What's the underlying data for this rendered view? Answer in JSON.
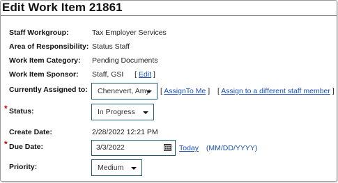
{
  "page_title": "Edit Work Item 21861",
  "fields": {
    "staff_workgroup": {
      "label": "Staff Workgroup:",
      "value": "Tax Employer Services"
    },
    "area": {
      "label": "Area of Responsibility:",
      "value": "Status Staff"
    },
    "category": {
      "label": "Work Item Category:",
      "value": "Pending Documents"
    },
    "sponsor": {
      "label": "Work Item Sponsor:",
      "value": "Staff, GSI",
      "edit_open": "[",
      "edit_link": "Edit",
      "edit_close": "]"
    },
    "assigned": {
      "label": "Currently Assigned to:",
      "selected": "Chenevert, Amy",
      "assign_me_open": "[",
      "assign_me_link": "AssignTo Me",
      "assign_me_close": "]",
      "assign_other_open": "[",
      "assign_other_link": "Assign to a different staff member",
      "assign_other_close": "]"
    },
    "status": {
      "required_mark": "*",
      "label": "Status:",
      "selected": "In Progress"
    },
    "create_date": {
      "label": "Create Date:",
      "value": "2/28/2022 12:21 PM"
    },
    "due_date": {
      "required_mark": "*",
      "label": "Due Date:",
      "value": "3/3/2022",
      "today_link": "Today",
      "format_hint": "(MM/DD/YYYY)"
    },
    "priority": {
      "label": "Priority:",
      "selected": "Medium"
    }
  },
  "icons": {
    "dropdown": "chevron-down-icon",
    "calendar": "calendar-icon"
  },
  "colors": {
    "link": "#1a4fb5",
    "required": "#c00000",
    "input_border": "#1b5c73"
  }
}
